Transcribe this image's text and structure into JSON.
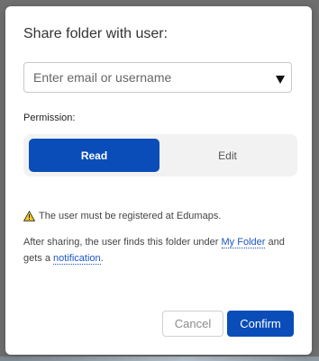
{
  "dialog": {
    "title": "Share folder with user:"
  },
  "recipient": {
    "placeholder": "Enter email or username"
  },
  "permission": {
    "label": "Permission:",
    "options": [
      "Read",
      "Edit"
    ],
    "selected": "Read"
  },
  "notes": {
    "warning": "The user must be registered at Edumaps.",
    "info_before": "After sharing, the user finds this folder under",
    "my_folder_link": "My Folder",
    "info_middle": "and gets a",
    "notification_link": "notification",
    "info_after": "."
  },
  "actions": {
    "cancel": "Cancel",
    "confirm": "Confirm"
  },
  "colors": {
    "accent": "#0a4db8",
    "link": "#1d56c4",
    "warning": "#f3c623"
  }
}
